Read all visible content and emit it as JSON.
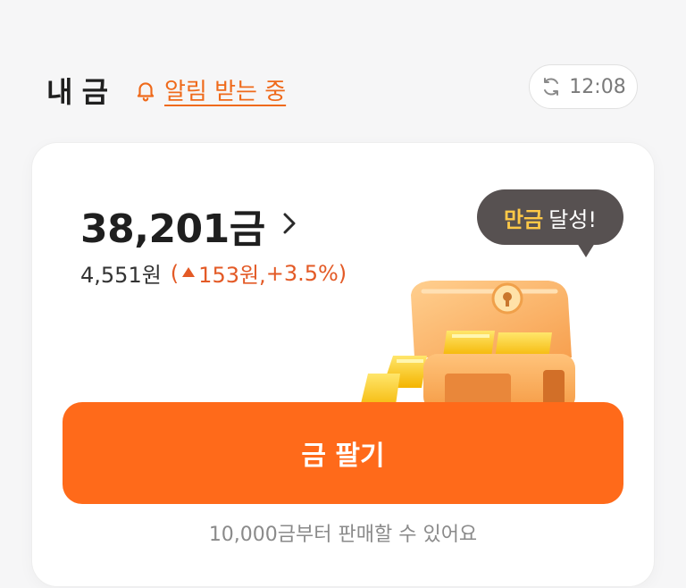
{
  "header": {
    "title": "내 금",
    "alert_label": "알림 받는 중",
    "time": "12:08"
  },
  "holding": {
    "amount": "38,201금",
    "value": "4,551원",
    "change_open": "(",
    "change_amount": "153원,",
    "change_percent": "+3.5%",
    "change_close": ")"
  },
  "badge": {
    "highlight": "만금",
    "text": "달성!"
  },
  "sell": {
    "button_label": "금 팔기",
    "note": "10,000금부터 판매할 수 있어요"
  },
  "colors": {
    "accent": "#ff6a1a",
    "alert": "#ef6a1b",
    "up": "#e35a26",
    "bubble": "#575151",
    "bubble_highlight": "#ffc947"
  },
  "icons": {
    "alert": "bell-icon",
    "refresh": "refresh-icon",
    "chevron": "chevron-right-icon",
    "up": "triangle-up-icon",
    "illustration": "gold-treasure-chest-illustration"
  }
}
